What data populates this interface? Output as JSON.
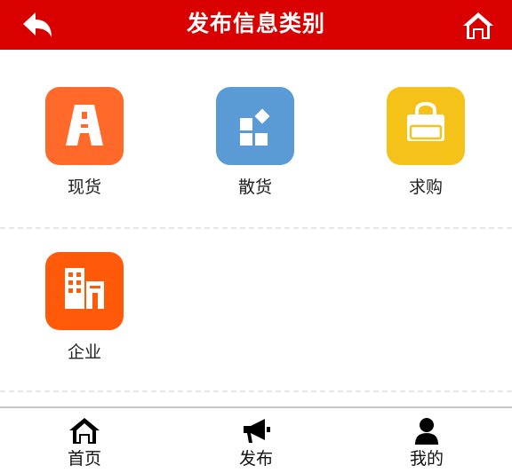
{
  "header": {
    "title": "发布信息类别",
    "back_icon": "back-arrow-icon",
    "home_icon": "home-icon",
    "background_color": "#d90000"
  },
  "categories": [
    {
      "label": "现货",
      "icon": "road-letter-a-icon",
      "color": "#ff6a2b"
    },
    {
      "label": "散货",
      "icon": "blocks-icon",
      "color": "#5b9bd5"
    },
    {
      "label": "求购",
      "icon": "shopping-bag-icon",
      "color": "#f5c21a"
    },
    {
      "label": "企业",
      "icon": "building-icon",
      "color": "#ff5a0a"
    }
  ],
  "bottom_nav": [
    {
      "label": "首页",
      "icon": "home-icon"
    },
    {
      "label": "发布",
      "icon": "megaphone-icon"
    },
    {
      "label": "我的",
      "icon": "user-icon"
    }
  ]
}
